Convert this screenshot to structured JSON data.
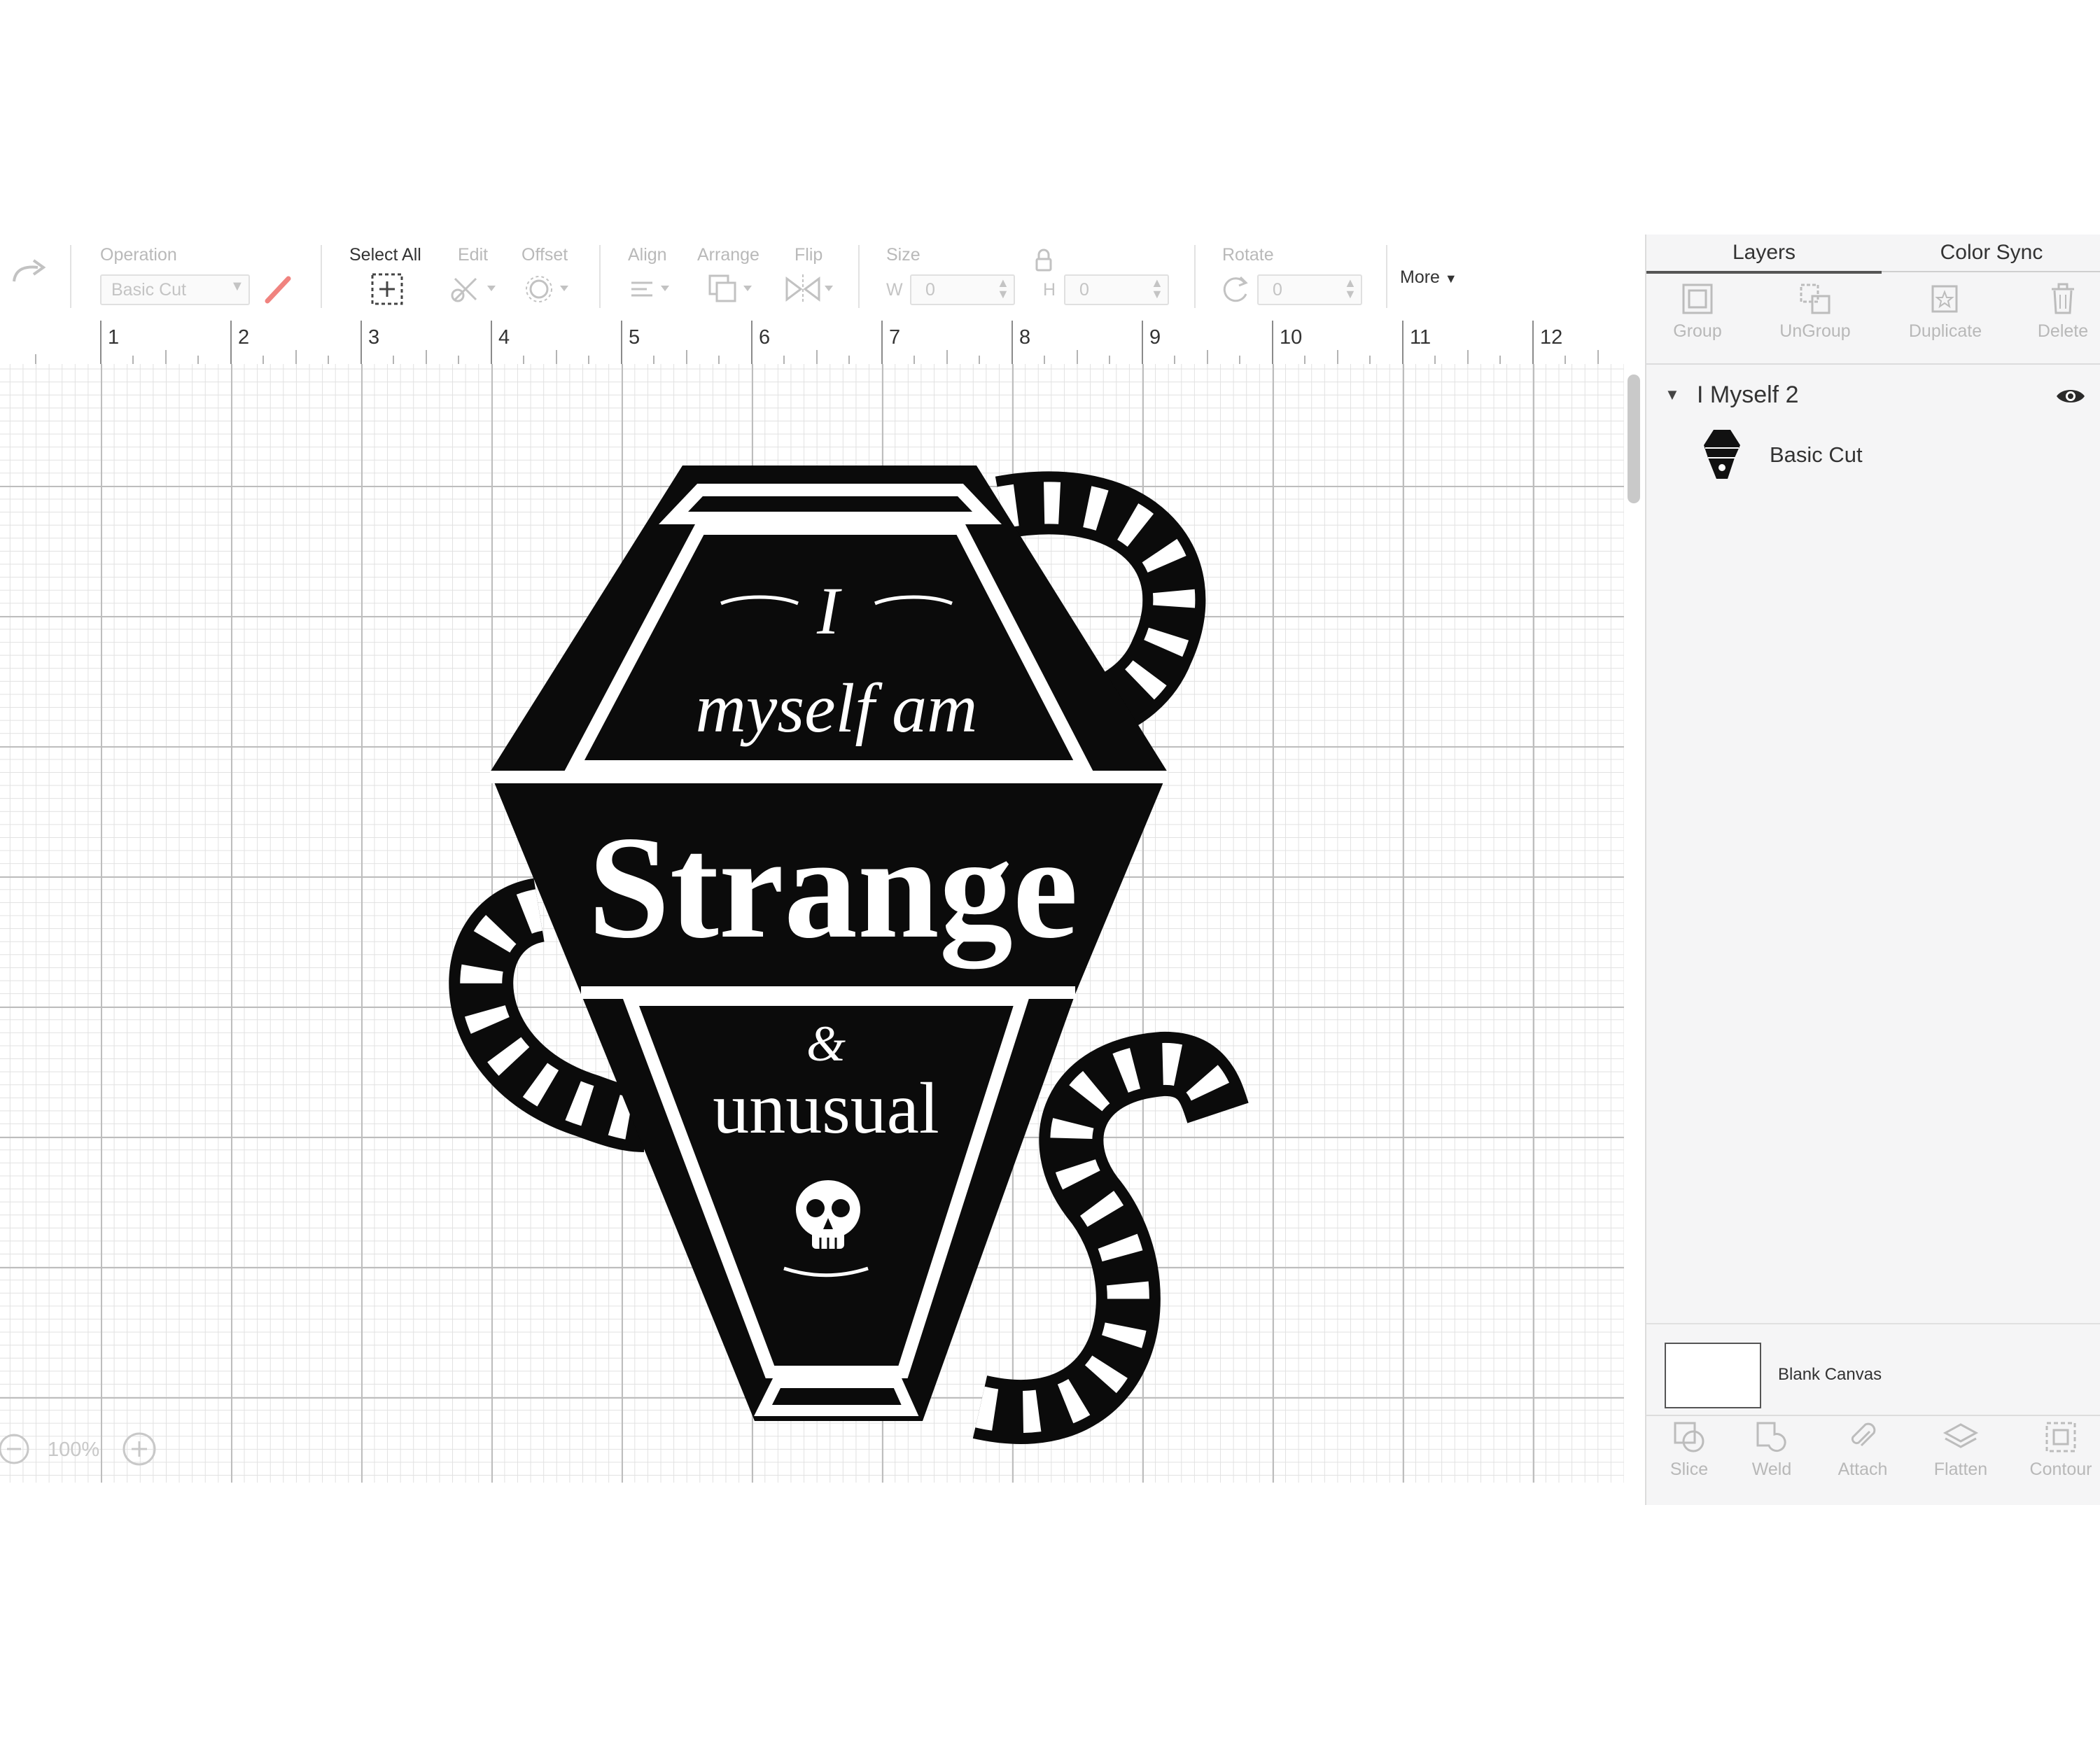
{
  "toolbar": {
    "operation_label": "Operation",
    "operation_value": "Basic Cut",
    "select_all_label": "Select All",
    "edit_label": "Edit",
    "offset_label": "Offset",
    "align_label": "Align",
    "arrange_label": "Arrange",
    "flip_label": "Flip",
    "size_label": "Size",
    "w_label": "W",
    "w_value": "0",
    "h_label": "H",
    "h_value": "0",
    "rotate_label": "Rotate",
    "rotate_value": "0",
    "more_label": "More"
  },
  "ruler": {
    "marks": [
      "1",
      "2",
      "3",
      "4",
      "5",
      "6",
      "7",
      "8",
      "9",
      "10",
      "11",
      "12"
    ]
  },
  "zoom": {
    "value": "100%"
  },
  "design": {
    "line1": "I",
    "line2": "myself am",
    "line3": "Strange",
    "line4": "&",
    "line5": "unusual"
  },
  "panel": {
    "tabs": {
      "layers": "Layers",
      "color_sync": "Color Sync"
    },
    "actions_top": {
      "group": "Group",
      "ungroup": "UnGroup",
      "duplicate": "Duplicate",
      "delete": "Delete"
    },
    "layer_group_name": "I Myself 2",
    "layer_item_label": "Basic Cut",
    "blank_canvas_label": "Blank Canvas",
    "actions_bottom": {
      "slice": "Slice",
      "weld": "Weld",
      "attach": "Attach",
      "flatten": "Flatten",
      "contour": "Contour"
    }
  }
}
